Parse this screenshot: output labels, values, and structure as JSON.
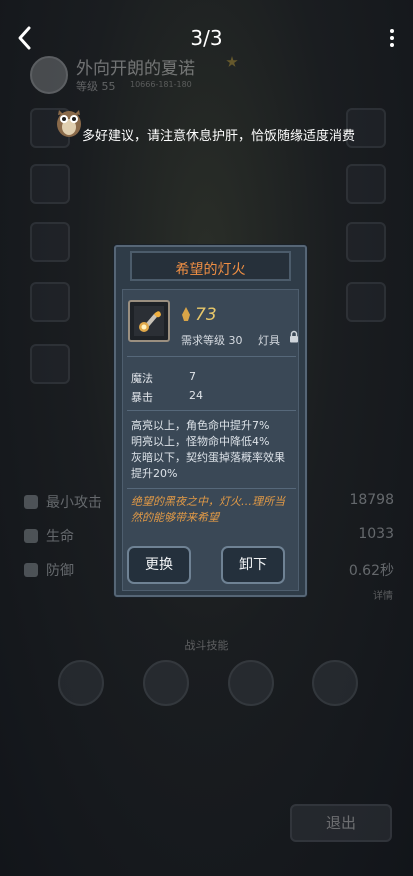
{
  "topbar": {
    "page_indicator": "3/3"
  },
  "player": {
    "name": "外向开朗的夏诺",
    "level": "等级 55",
    "id_line": "10666-181-180"
  },
  "tip": {
    "text": "多好建议，请注意休息护肝，恰饭随缘适度消费"
  },
  "stats": [
    {
      "label": "最小攻击",
      "value": "18798",
      "icon": "sword-icon"
    },
    {
      "label": "生命",
      "value": "1033",
      "icon": "heart-icon"
    },
    {
      "label": "防御",
      "value": "0.62秒",
      "icon": "shield-icon"
    }
  ],
  "detail_link": "详情",
  "skills_title": "战斗技能",
  "exit_label": "退出",
  "modal": {
    "title": "希望的灯火",
    "power": "73",
    "required_level": "需求等级 30",
    "type": "灯具",
    "attributes": [
      {
        "name": "魔法",
        "value": "7"
      },
      {
        "name": "暴击",
        "value": "24"
      }
    ],
    "effect_lines": [
      "高亮以上，角色命中提升7%",
      "明亮以上，怪物命中降低4%",
      "灰暗以下，契约蛋掉落概率效果",
      "提升20%"
    ],
    "lore_lines": [
      "绝望的黑夜之中，灯火…理所当",
      "然的能够带来希望"
    ],
    "replace_label": "更换",
    "unequip_label": "卸下"
  },
  "colors": {
    "title_orange": "#f08f44",
    "power_gold": "#e8c86a",
    "lore_orange": "#e29a46",
    "modal_bg": "#2f3c48"
  }
}
